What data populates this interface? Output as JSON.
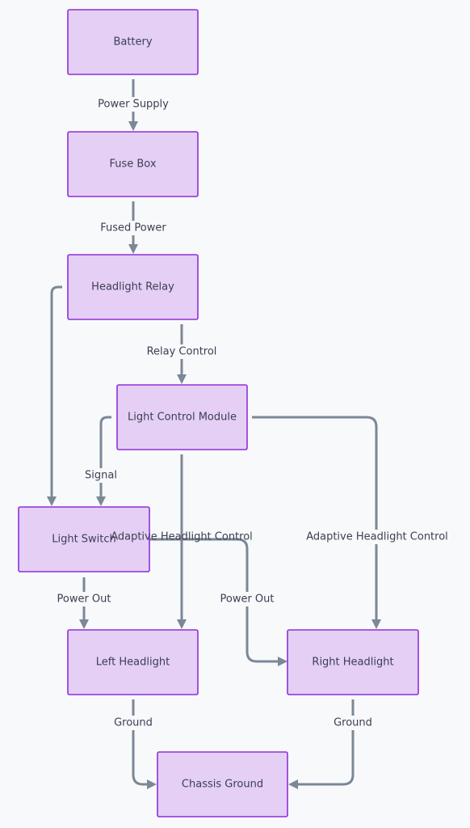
{
  "diagram": {
    "type": "flowchart",
    "colors": {
      "node_fill": "#e5cff4",
      "node_stroke": "#8f2fd9",
      "edge": "#7b8896",
      "background": "#f8f9fb",
      "text": "#3a3f52"
    },
    "nodes": {
      "battery": "Battery",
      "fuse_box": "Fuse Box",
      "headlight_relay": "Headlight Relay",
      "light_control_module": "Light Control Module",
      "light_switch": "Light Switch",
      "left_headlight": "Left Headlight",
      "right_headlight": "Right Headlight",
      "chassis_ground": "Chassis Ground"
    },
    "edges": [
      {
        "from": "battery",
        "to": "fuse_box",
        "label": "Power Supply"
      },
      {
        "from": "fuse_box",
        "to": "headlight_relay",
        "label": "Fused Power"
      },
      {
        "from": "headlight_relay",
        "to": "light_switch",
        "label": ""
      },
      {
        "from": "headlight_relay",
        "to": "light_control_module",
        "label": "Relay Control"
      },
      {
        "from": "light_control_module",
        "to": "light_switch",
        "label": "Signal"
      },
      {
        "from": "light_control_module",
        "to": "left_headlight",
        "label": "Adaptive Headlight Control"
      },
      {
        "from": "light_control_module",
        "to": "right_headlight",
        "label": "Adaptive Headlight Control"
      },
      {
        "from": "light_switch",
        "to": "left_headlight",
        "label": "Power Out"
      },
      {
        "from": "light_switch",
        "to": "right_headlight",
        "label": "Power Out"
      },
      {
        "from": "left_headlight",
        "to": "chassis_ground",
        "label": "Ground"
      },
      {
        "from": "right_headlight",
        "to": "chassis_ground",
        "label": "Ground"
      }
    ]
  }
}
